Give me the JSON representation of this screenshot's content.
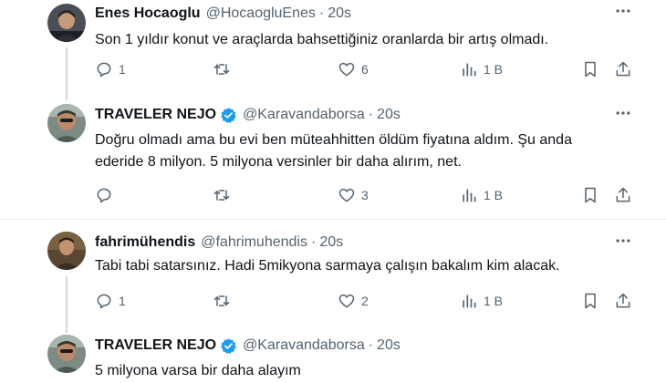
{
  "tweets": [
    {
      "name": "Enes Hocaoglu",
      "handle": "@HocaogluEnes",
      "time": "20s",
      "verified": false,
      "text": "Son 1 yıldır konut ve araçlarda bahsettiğiniz oranlarda bir artış olmadı.",
      "replies": "1",
      "retweets": "",
      "likes": "6",
      "views": "1 B"
    },
    {
      "name": "TRAVELER NEJO",
      "handle": "@Karavandaborsa",
      "time": "20s",
      "verified": true,
      "text": "Doğru olmadı ama bu evi ben müteahhitten öldüm fiyatına aldım. Şu anda ederide 8 milyon. 5 milyona versinler bir daha alırım, net.",
      "replies": "",
      "retweets": "",
      "likes": "3",
      "views": "1 B"
    },
    {
      "name": "fahrimühendis",
      "handle": "@fahrimuhendis",
      "time": "20s",
      "verified": false,
      "text": "Tabi tabi satarsınız. Hadi 5mikyona sarmaya çalışın bakalım kim alacak.",
      "replies": "1",
      "retweets": "",
      "likes": "2",
      "views": "1 B"
    },
    {
      "name": "TRAVELER NEJO",
      "handle": "@Karavandaborsa",
      "time": "20s",
      "verified": true,
      "text": "5 milyona varsa bir daha alayım"
    }
  ],
  "separator": "·",
  "colors": {
    "accent": "#1d9bf0",
    "muted": "#536471",
    "text": "#0f1419"
  },
  "icons": [
    "more-icon",
    "reply-icon",
    "retweet-icon",
    "like-icon",
    "views-icon",
    "bookmark-icon",
    "share-icon",
    "verified-badge-icon"
  ]
}
